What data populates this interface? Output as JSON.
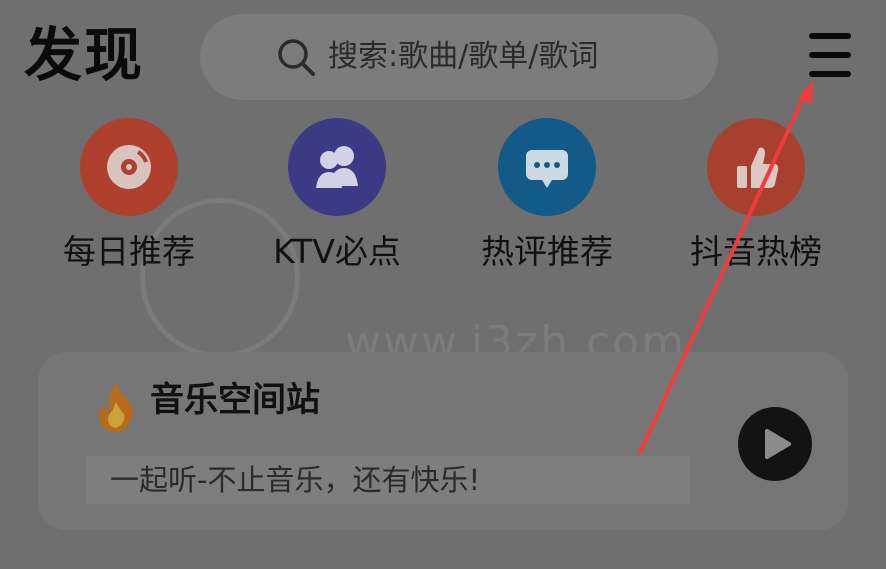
{
  "header": {
    "title": "发现",
    "search_placeholder": "搜索:歌曲/歌单/歌词"
  },
  "shortcuts": [
    {
      "label": "每日推荐",
      "icon": "disc-icon",
      "color": "#b0402e"
    },
    {
      "label": "KTV必点",
      "icon": "people-icon",
      "color": "#3c3a85"
    },
    {
      "label": "热评推荐",
      "icon": "comment-icon",
      "color": "#125a87"
    },
    {
      "label": "抖音热榜",
      "icon": "thumbs-up-icon",
      "color": "#a8402f"
    }
  ],
  "watermark": {
    "text": "www.i3zh.com"
  },
  "card": {
    "title": "音乐空间站",
    "subtitle": "一起听-不止音乐，还有快乐!"
  },
  "colors": {
    "overlay": "#6f6f6f",
    "annotation_arrow": "#f23b3b"
  }
}
